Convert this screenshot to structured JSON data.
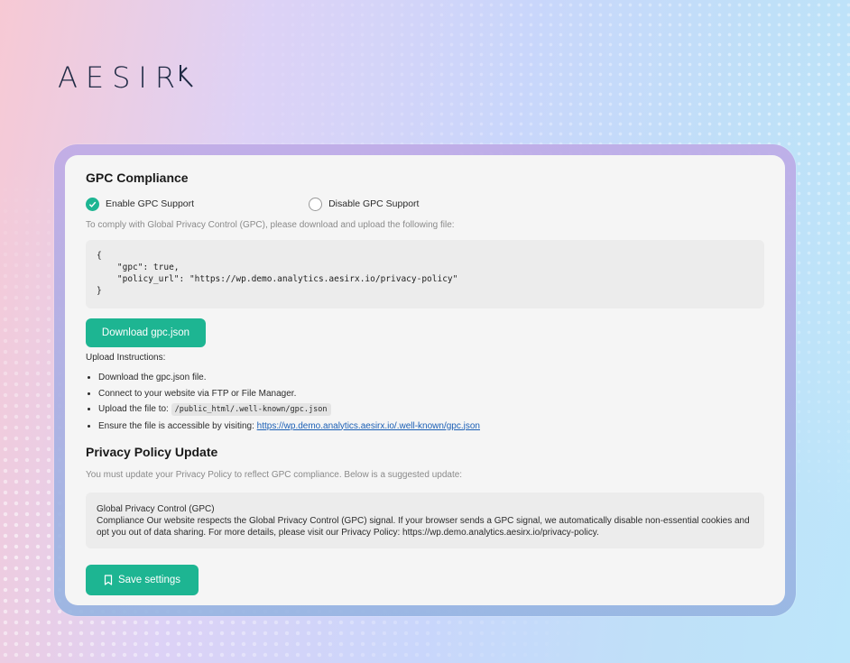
{
  "brand": {
    "logo_text": "AESIR",
    "accent": "#1db592"
  },
  "gpc": {
    "title": "GPC Compliance",
    "options": [
      {
        "label": "Enable GPC Support",
        "selected": true
      },
      {
        "label": "Disable GPC Support",
        "selected": false
      }
    ],
    "instruction": "To comply with Global Privacy Control (GPC), please download and upload the following file:",
    "code": "{\n    \"gpc\": true,\n    \"policy_url\": \"https://wp.demo.analytics.aesirx.io/privacy-policy\"\n}",
    "download_label": "Download gpc.json",
    "upload_title": "Upload Instructions:",
    "steps": {
      "step1": "Download the gpc.json file.",
      "step2": "Connect to your website via FTP or File Manager.",
      "step3_prefix": "Upload the file to:",
      "step3_path": "/public_html/.well-known/gpc.json",
      "step4_prefix": "Ensure the file is accessible by visiting:",
      "step4_link": "https://wp.demo.analytics.aesirx.io/.well-known/gpc.json"
    }
  },
  "policy": {
    "title": "Privacy Policy Update",
    "instruction": "You must update your Privacy Policy to reflect GPC compliance. Below is a suggested update:",
    "heading": "Global Privacy Control (GPC)",
    "body": "Compliance Our website respects the Global Privacy Control (GPC) signal. If your browser sends a GPC signal, we automatically disable non-essential cookies and opt you out of data sharing. For more details, please visit our Privacy Policy: https://wp.demo.analytics.aesirx.io/privacy-policy.",
    "save_label": "Save settings"
  }
}
